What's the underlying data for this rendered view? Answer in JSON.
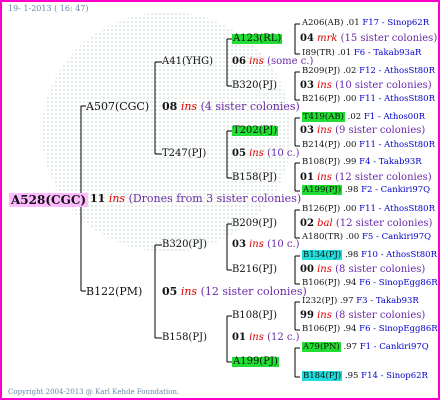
{
  "header_date": "19- 1-2013 ( 16: 47)",
  "copyright": "Copyright 2004-2013 @ Karl Kehde Foundation.",
  "root": {
    "id": "A528(CGC)",
    "num": "11",
    "ins": "ins",
    "note": "(Drones from 3 sister colonies)"
  },
  "l2": {
    "sire": {
      "id": "A507(CGC)",
      "num": "08",
      "ins": "ins",
      "note": "(4 sister colonies)"
    },
    "dam": {
      "id": "B122(PM)",
      "num": "05",
      "ins": "ins",
      "note": "(12 sister colonies)"
    }
  },
  "l3": [
    {
      "id": "A41(YHG)",
      "num": "06",
      "ins": "ins",
      "note": "(some c.)"
    },
    {
      "id": "T247(PJ)",
      "num": "05",
      "ins": "ins",
      "note": "(10 c.)"
    },
    {
      "id": "B320(PJ)",
      "num": "03",
      "ins": "ins",
      "note": "(10 c.)"
    },
    {
      "id": "B158(PJ)",
      "num": "01",
      "ins": "ins",
      "note": "(12 c.)"
    }
  ],
  "l4": [
    {
      "id": "A123(RL)",
      "num": "04",
      "ins": "mrk",
      "note": "(15 sister colonies)"
    },
    {
      "id": "B320(PJ)",
      "num": "03",
      "ins": "ins",
      "note": "(10 sister colonies)"
    },
    {
      "id": "T202(PJ)",
      "num": "03",
      "ins": "ins",
      "note": "(9 sister colonies)"
    },
    {
      "id": "B158(PJ)",
      "num": "01",
      "ins": "ins",
      "note": "(12 sister colonies)"
    },
    {
      "id": "B209(PJ)",
      "num": "02",
      "ins": "bal",
      "note": "(12 sister colonies)"
    },
    {
      "id": "B216(PJ)",
      "num": "00",
      "ins": "ins",
      "note": "(8 sister colonies)"
    },
    {
      "id": "B108(PJ)",
      "num": "99",
      "ins": "ins",
      "note": "(8 sister colonies)"
    },
    {
      "id": "A199(PJ)",
      "num": "98",
      "ins": "ins",
      "note": "(8 sister colonies)"
    }
  ],
  "l5": [
    {
      "id": "A206(AB)",
      "val": ".01",
      "dir": "F17 - Sinop62R",
      "hl": ""
    },
    {
      "id": "I89(TR)",
      "val": ".01",
      "dir": "F6 - Takab93aR",
      "hl": ""
    },
    {
      "id": "B209(PJ)",
      "val": ".02",
      "dir": "F12 - AthosSt80R",
      "hl": ""
    },
    {
      "id": "B216(PJ)",
      "val": ".00",
      "dir": "F11 - AthosSt80R",
      "hl": ""
    },
    {
      "id": "T419(AB)",
      "val": ".02",
      "dir": "F1 - Athos00R",
      "hl": "g"
    },
    {
      "id": "B214(PJ)",
      "val": ".00",
      "dir": "F11 - AthosSt80R",
      "hl": ""
    },
    {
      "id": "B108(PJ)",
      "val": ".99",
      "dir": "F4 - Takab93R",
      "hl": ""
    },
    {
      "id": "A199(PJ)",
      "val": ".98",
      "dir": "F2 - Cankiri97Q",
      "hl": "g"
    },
    {
      "id": "B126(PJ)",
      "val": ".00",
      "dir": "F11 - AthosSt80R",
      "hl": ""
    },
    {
      "id": "A180(TR)",
      "val": ".00",
      "dir": "F5 - Cankiri97Q",
      "hl": ""
    },
    {
      "id": "B134(PJ)",
      "val": ".98",
      "dir": "F10 - AthosSt80R",
      "hl": "c"
    },
    {
      "id": "B106(PJ)",
      "val": ".94",
      "dir": "F6 - SinopEgg86R",
      "hl": ""
    },
    {
      "id": "I232(PJ)",
      "val": ".97",
      "dir": "F3 - Takab93R",
      "hl": ""
    },
    {
      "id": "B106(PJ)",
      "val": ".94",
      "dir": "F6 - SinopEgg86R",
      "hl": ""
    },
    {
      "id": "A79(PN)",
      "val": ".97",
      "dir": "F1 - Cankiri97Q",
      "hl": "g"
    },
    {
      "id": "B184(PJ)",
      "val": ".95",
      "dir": "F14 - Sinop62R",
      "hl": "c"
    }
  ],
  "colors": {
    "frame": "#ff00cc",
    "root_highlight": "#ffbbff",
    "green_highlight": "#22dd33",
    "cyan_highlight": "#22dddd",
    "ins": "#dd0000",
    "sister_note": "#6a2aa8",
    "origin": "#0000cc"
  }
}
